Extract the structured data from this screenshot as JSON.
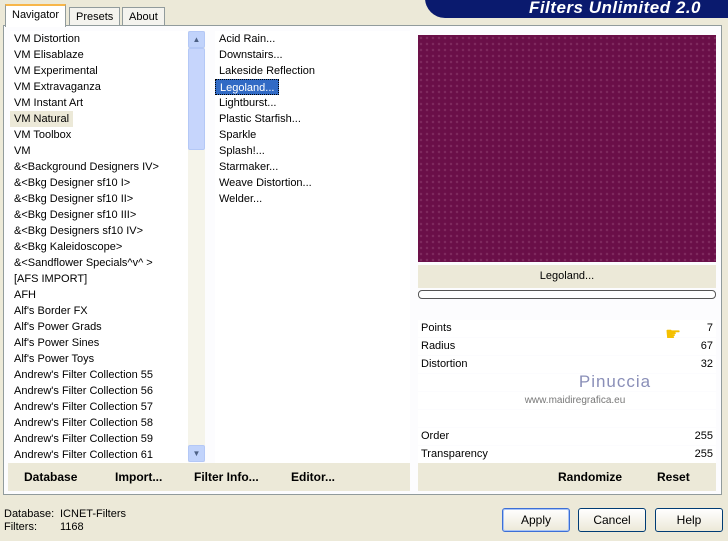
{
  "app": {
    "title": "Filters Unlimited 2.0"
  },
  "tabs": [
    {
      "label": "Navigator"
    },
    {
      "label": "Presets"
    },
    {
      "label": "About"
    }
  ],
  "categories": [
    "VM Distortion",
    "VM Elisablaze",
    "VM Experimental",
    "VM Extravaganza",
    "VM Instant Art",
    "VM Natural",
    "VM Toolbox",
    "VM",
    "&<Background Designers IV>",
    "&<Bkg Designer sf10 I>",
    "&<Bkg Designer sf10 II>",
    "&<Bkg Designer sf10 III>",
    "&<Bkg Designers sf10 IV>",
    "&<Bkg Kaleidoscope>",
    "&<Sandflower Specials^v^ >",
    "[AFS IMPORT]",
    "AFH",
    "Alf's Border FX",
    "Alf's Power Grads",
    "Alf's Power Sines",
    "Alf's Power Toys",
    "Andrew's Filter Collection 55",
    "Andrew's Filter Collection 56",
    "Andrew's Filter Collection 57",
    "Andrew's Filter Collection 58",
    "Andrew's Filter Collection 59",
    "Andrew's Filter Collection 61"
  ],
  "selected_category": "VM Natural",
  "filters": [
    "Acid Rain...",
    "Downstairs...",
    "Lakeside Reflection",
    "Legoland...",
    "Lightburst...",
    "Plastic Starfish...",
    "Sparkle",
    "Splash!...",
    "Starmaker...",
    "Weave Distortion...",
    "Welder..."
  ],
  "selected_filter": "Legoland...",
  "filter_name": "Legoland...",
  "progress": 0,
  "params": [
    {
      "label": "Points",
      "value": "7"
    },
    {
      "label": "Radius",
      "value": "67"
    },
    {
      "label": "Distortion",
      "value": "32"
    },
    {
      "label": "",
      "value": ""
    },
    {
      "label": "",
      "value": ""
    },
    {
      "label": "",
      "value": ""
    },
    {
      "label": "Order",
      "value": "255"
    },
    {
      "label": "Transparency",
      "value": "255"
    }
  ],
  "watermark": {
    "name": "Pinuccia",
    "url": "www.maidiregrafica.eu"
  },
  "left_buttons": {
    "database": "Database",
    "import": "Import...",
    "filter_info": "Filter Info...",
    "editor": "Editor..."
  },
  "right_buttons": {
    "randomize": "Randomize",
    "reset": "Reset"
  },
  "status": {
    "database_label": "Database:",
    "database_value": "ICNET-Filters",
    "filters_label": "Filters:",
    "filters_value": "1168"
  },
  "dialog_buttons": {
    "apply": "Apply",
    "cancel": "Cancel",
    "help": "Help"
  }
}
